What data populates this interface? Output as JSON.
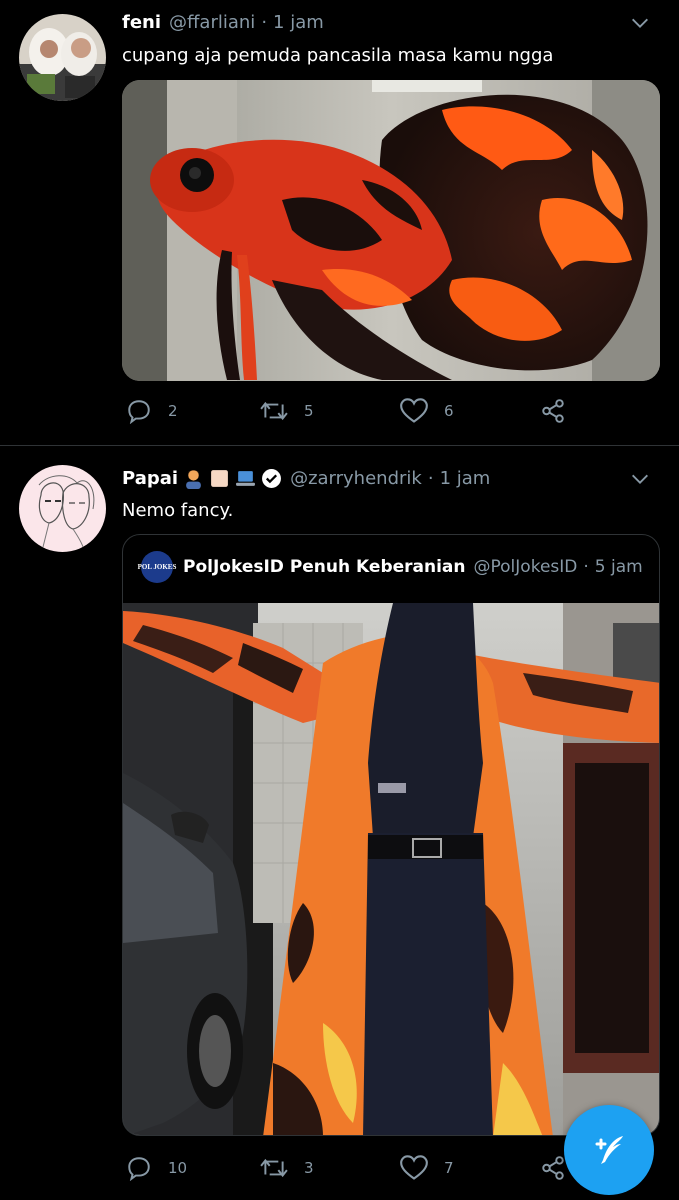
{
  "tweets": [
    {
      "name": "feni",
      "handle": "@ffarliani",
      "time": "1 jam",
      "text": "cupang aja pemuda pancasila masa kamu ngga",
      "replies": "2",
      "retweets": "5",
      "likes": "6"
    },
    {
      "name": "Papai",
      "handle": "@zarryhendrik",
      "time": "1 jam",
      "text": "Nemo fancy.",
      "replies": "10",
      "retweets": "3",
      "likes": "7",
      "quoted": {
        "name": "PolJokesID Penuh Keberanian",
        "handle": "@PolJokesID",
        "time": "5 jam",
        "avatar_text": "POL JOKES"
      }
    }
  ],
  "separator": "·",
  "icons": {
    "reply": "reply-icon",
    "retweet": "retweet-icon",
    "like": "like-icon",
    "share": "share-icon",
    "more": "chevron-down-icon",
    "verified": "verified-badge-icon",
    "compose": "compose-tweet-icon"
  },
  "colors": {
    "background": "#000000",
    "secondary_text": "#8899a6",
    "accent": "#1da1f2",
    "divider": "#2f3336"
  }
}
